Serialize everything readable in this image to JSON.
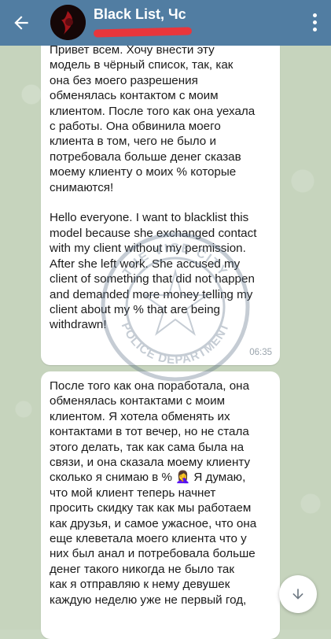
{
  "header": {
    "title": "Black List, Чс",
    "back_icon": "arrow-left-icon",
    "menu_icon": "more-vertical-icon",
    "color": "#517da2"
  },
  "messages": [
    {
      "text": "Привет всем. Хочу внести эту\nмодель в чёрный список, так, как\nона без моего разрешения\nобменялась контактом с моим\nклиентом. После того как она уехала\nс работы. Она обвинила моего\nклиента в том, чего не было и\nпотребовала больше денег сказав\nмоему клиенту о моих % которые\nснимаются!\n\nHello everyone. I want to blacklist this\nmodel because she exchanged contact\nwith my client without my permission.\nAfter she left work. She accused my\nclient of something that did not happen\nand demanded more money telling my\nclient about my % that are being\nwithdrawn!",
      "time": "06:35"
    },
    {
      "text": "После того как она поработала, она\nобменялась контактами с моим\nклиентом. Я хотела обменять их\nконтактами в тот вечер, но не стала\nэтого делать, так как сама была на\nсвязи, и она сказала моему клиенту\nсколько я снимаю в % 🤦‍♀️ Я думаю,\nчто мой клиент теперь начнет\nпросить скидку так как мы работаем\nкак друзья, и самое ужасное, что она\nеще клеветала моего клиента что у\nних был анал и потребовала больше\nденег такого никогда не было так\nкак я отправляю к нему девушек\nкаждую неделю уже не первый год,"
    }
  ],
  "watermark": {
    "top_text": "THE VICE CITY",
    "bottom_text": "POLICE DEPARTMENT"
  },
  "scroll_button_icon": "arrow-down-icon"
}
